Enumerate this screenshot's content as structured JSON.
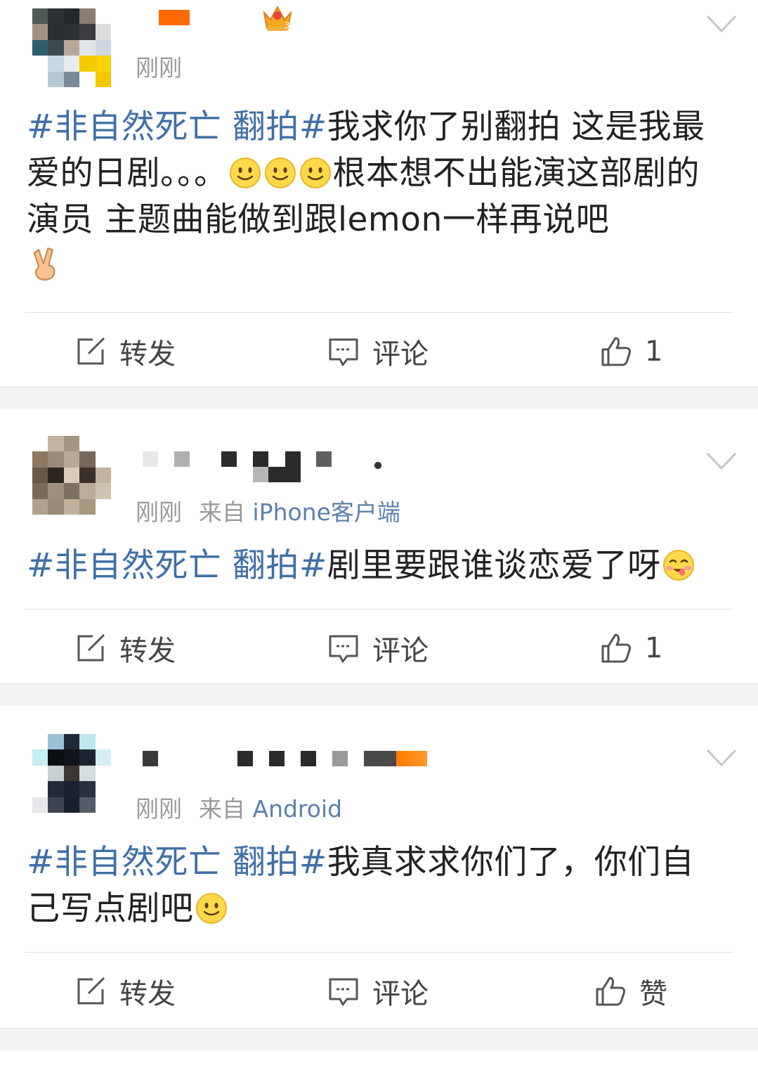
{
  "posts": [
    {
      "time": "刚刚",
      "source_prefix": "",
      "source": "",
      "text": {
        "tag": "#非自然死亡 翻拍#",
        "body1": "我求你了别翻拍 这是我最爱的日剧。。。",
        "body2": "根本想不出能演这部剧的演员 主题曲能做到跟lemon一样再说吧"
      },
      "emoji": [
        "smile-emoji",
        "smile-emoji",
        "smile-emoji",
        "victory-hand-emoji"
      ],
      "actions": {
        "repost": "转发",
        "comment": "评论",
        "like": "1"
      }
    },
    {
      "time": "刚刚",
      "source_prefix": "来自",
      "source": "iPhone客户端",
      "text": {
        "tag": "#非自然死亡 翻拍#",
        "body1": "剧里要跟谁谈恋爱了呀",
        "body2": ""
      },
      "emoji": [
        "yummy-emoji"
      ],
      "actions": {
        "repost": "转发",
        "comment": "评论",
        "like": "1"
      }
    },
    {
      "time": "刚刚",
      "source_prefix": "来自",
      "source": "Android",
      "text": {
        "tag": "#非自然死亡 翻拍#",
        "body1": "我真求求你们了，你们自己写点剧吧",
        "body2": ""
      },
      "emoji": [
        "smile-emoji"
      ],
      "actions": {
        "repost": "转发",
        "comment": "评论",
        "like": "赞"
      }
    }
  ],
  "colors": {
    "hashtag": "#3f6fa6",
    "source_link": "#5c7fab",
    "meta_gray": "#9a9a9a",
    "separator": "#f2f2f2",
    "vip_orange": "#ff6a00"
  }
}
